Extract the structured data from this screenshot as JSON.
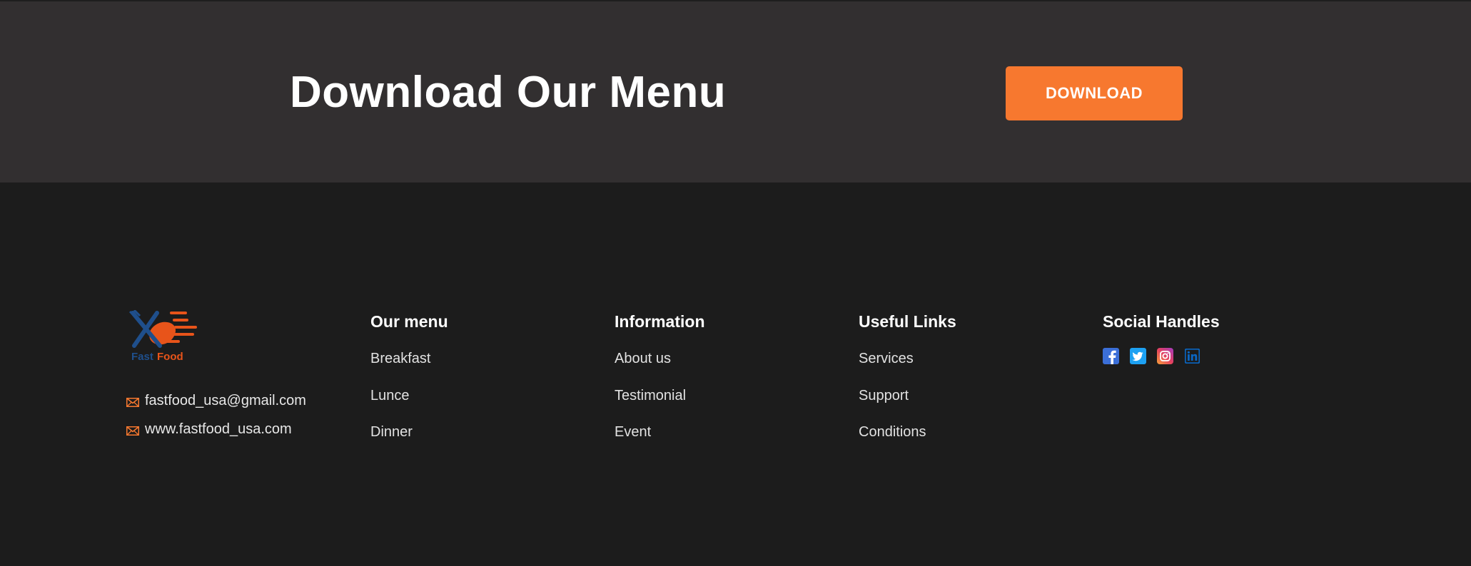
{
  "banner": {
    "title": "Download Our Menu",
    "button_label": "DOWNLOAD"
  },
  "brand": {
    "logo_text_1": "Fast",
    "logo_text_2": "Food",
    "colors": {
      "accent": "#f7782f",
      "logo_blue": "#1f4f8c",
      "logo_orange": "#e8541a",
      "banner_bg": "#322f30",
      "footer_bg": "#1c1c1c"
    }
  },
  "contact": {
    "email": "fastfood_usa@gmail.com",
    "website": "www.fastfood_usa.com",
    "icon": "mail-icon"
  },
  "columns": {
    "menu": {
      "title": "Our menu",
      "links": [
        "Breakfast",
        "Lunce",
        "Dinner"
      ]
    },
    "information": {
      "title": "Information",
      "links": [
        "About us",
        "Testimonial",
        "Event"
      ]
    },
    "useful": {
      "title": "Useful Links",
      "links": [
        "Services",
        "Support",
        "Conditions"
      ]
    },
    "social": {
      "title": "Social Handles",
      "icons": [
        "facebook-icon",
        "twitter-icon",
        "instagram-icon",
        "linkedin-icon"
      ]
    }
  }
}
